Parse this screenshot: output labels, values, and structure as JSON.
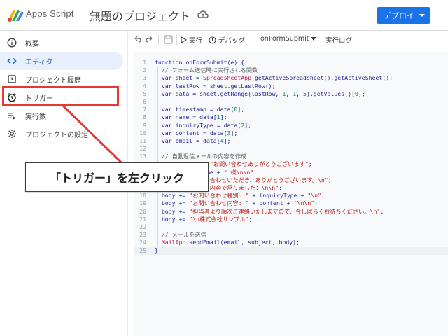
{
  "header": {
    "app_name": "Apps Script",
    "project_title": "無題のプロジェクト",
    "deploy_label": "デプロイ",
    "cloud_icon": "cloud-sync-icon",
    "accent": "#1a73e8"
  },
  "sidebar": {
    "items": [
      {
        "label": "概要",
        "icon": "info-icon"
      },
      {
        "label": "エディタ",
        "icon": "code-icon"
      },
      {
        "label": "プロジェクト履歴",
        "icon": "history-icon"
      },
      {
        "label": "トリガー",
        "icon": "alarm-clock-icon"
      },
      {
        "label": "実行数",
        "icon": "list-play-icon"
      },
      {
        "label": "プロジェクトの設定",
        "icon": "gear-icon"
      }
    ],
    "active_index": 1,
    "active_color": "#e8f0fe"
  },
  "toolbar": {
    "undo_icon": "undo-icon",
    "redo_icon": "redo-icon",
    "save_icon": "save-icon",
    "run_label": "実行",
    "debug_label": "デバッグ",
    "function_select": "onFormSubmit",
    "log_label": "実行ログ"
  },
  "code": {
    "lines": [
      {
        "n": "1",
        "text": "function onFormSubmit(e) {"
      },
      {
        "n": "2",
        "text": "  // フォーム送信時に実行される関数"
      },
      {
        "n": "3",
        "text": "  var sheet = SpreadsheetApp.getActiveSpreadsheet().getActiveSheet();"
      },
      {
        "n": "4",
        "text": "  var lastRow = sheet.getLastRow();"
      },
      {
        "n": "5",
        "text": "  var data = sheet.getRange(lastRow, 1, 1, 5).getValues()[0];"
      },
      {
        "n": "6",
        "text": ""
      },
      {
        "n": "7",
        "text": "  var timestamp = data[0];"
      },
      {
        "n": "8",
        "text": "  var name = data[1];"
      },
      {
        "n": "9",
        "text": "  var inquiryType = data[2];"
      },
      {
        "n": "10",
        "text": "  var content = data[3];"
      },
      {
        "n": "11",
        "text": "  var email = data[4];"
      },
      {
        "n": "12",
        "text": ""
      },
      {
        "n": "13",
        "text": "  // 自動返信メールの内容を作成"
      },
      {
        "n": "14",
        "text": "  var subject = \"お問い合わせありがとうございます\";"
      },
      {
        "n": "15",
        "text": "  var body = name + \" 様\\n\\n\";"
      },
      {
        "n": "16",
        "text": "  body += \"お問い合わせいただき、ありがとうございます。\\n\";"
      },
      {
        "n": "17",
        "text": "  body += \"以下の内容で承りました：\\n\\n\";"
      },
      {
        "n": "18",
        "text": "  body += \"お問い合わせ種別: \" + inquiryType + \"\\n\";"
      },
      {
        "n": "19",
        "text": "  body += \"お問い合わせ内容: \" + content + \"\\n\\n\";"
      },
      {
        "n": "20",
        "text": "  body += \"担当者より順次ご連絡いたしますので、今しばらくお待ちください。\\n\";"
      },
      {
        "n": "21",
        "text": "  body += \"\\n株式会社サンプル\";"
      },
      {
        "n": "22",
        "text": ""
      },
      {
        "n": "23",
        "text": "  // メールを送信"
      },
      {
        "n": "24",
        "text": "  MailApp.sendEmail(email, subject, body);"
      },
      {
        "n": "25",
        "text": "}"
      }
    ]
  },
  "annotation": {
    "callout_text": "「トリガー」を左クリック",
    "highlight_color": "#e53935"
  }
}
